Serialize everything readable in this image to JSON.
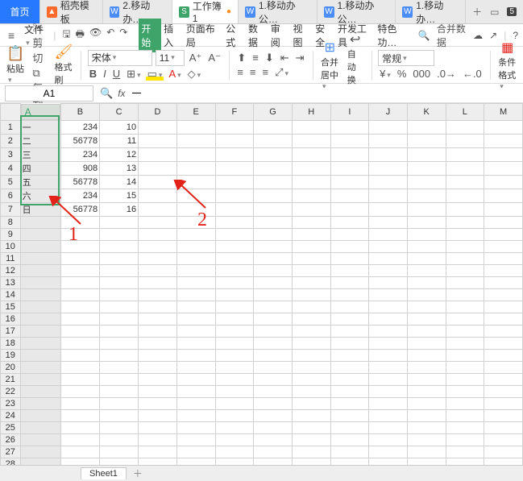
{
  "tabs": {
    "home": "首页",
    "t1": "稻壳模板",
    "t2": "2.移动办…",
    "t3": "工作簿1",
    "t4": "1.移动办公…",
    "t5": "1.移动办公…",
    "t6": "1.移动办…",
    "badge": "5"
  },
  "menubar": {
    "file": "文件",
    "items": [
      "开始",
      "插入",
      "页面布局",
      "公式",
      "数据",
      "审阅",
      "视图",
      "安全",
      "开发工具",
      "特色功…"
    ],
    "merge": "合并数据"
  },
  "ribbon": {
    "paste": "粘贴",
    "cut": "剪切",
    "copy": "复制",
    "brush": "格式刷",
    "font": "宋体",
    "size": "11",
    "bold": "B",
    "italic": "I",
    "under": "U",
    "mergeCenter": "合并居中",
    "autoWrap": "自动换行",
    "regular": "常规",
    "condfmt": "条件格式"
  },
  "namebox": "A1",
  "fxvalue": "一",
  "chart_data": {
    "type": "table",
    "columns": [
      "A",
      "B",
      "C"
    ],
    "rows": [
      {
        "A": "一",
        "B": 234,
        "C": 10
      },
      {
        "A": "二",
        "B": 56778,
        "C": 11
      },
      {
        "A": "三",
        "B": 234,
        "C": 12
      },
      {
        "A": "四",
        "B": 908,
        "C": 13
      },
      {
        "A": "五",
        "B": 56778,
        "C": 14
      },
      {
        "A": "六",
        "B": 234,
        "C": 15
      },
      {
        "A": "日",
        "B": 56778,
        "C": 16
      }
    ]
  },
  "colheaders": [
    "A",
    "B",
    "C",
    "D",
    "E",
    "F",
    "G",
    "H",
    "I",
    "J",
    "K",
    "L",
    "M"
  ],
  "rowcount": 29,
  "anno": {
    "n1": "1",
    "n2": "2"
  },
  "sheet": "Sheet1"
}
